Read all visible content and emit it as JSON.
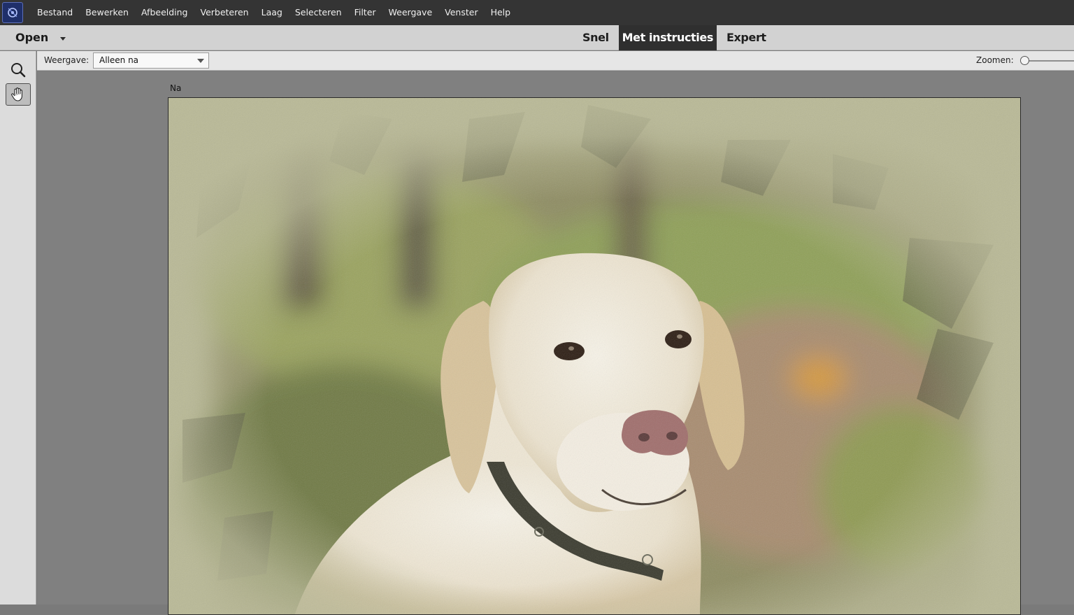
{
  "menu": {
    "items": [
      "Bestand",
      "Bewerken",
      "Afbeelding",
      "Verbeteren",
      "Laag",
      "Selecteren",
      "Filter",
      "Weergave",
      "Venster",
      "Help"
    ]
  },
  "modebar": {
    "open_label": "Open",
    "tabs": [
      {
        "label": "Snel"
      },
      {
        "label": "Met instructies"
      },
      {
        "label": "Expert"
      }
    ],
    "active_tab": "Met instructies"
  },
  "tools": [
    {
      "icon": "zoom-icon"
    },
    {
      "icon": "hand-icon",
      "selected": true
    }
  ],
  "options": {
    "view_label": "Weergave:",
    "view_value": "Alleen na",
    "zoom_label": "Zoomen:"
  },
  "canvas": {
    "panel_label": "Na"
  },
  "colors": {
    "menubar": "#343434",
    "modebar": "#d2d2d2",
    "active_tab": "#2f2f2f",
    "workspace": "#808080",
    "frame_bg": "#b9b996"
  }
}
